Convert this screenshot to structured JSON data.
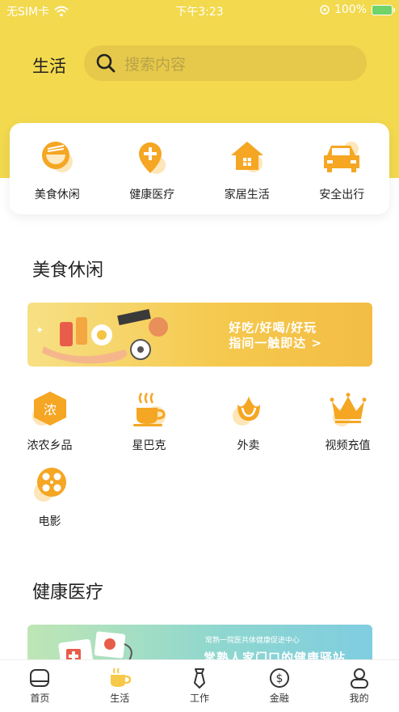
{
  "status_bar": {
    "carrier": "无SIM卡",
    "time": "下午3:23",
    "battery": "100%"
  },
  "header": {
    "title": "生活",
    "search_placeholder": "搜索内容"
  },
  "categories": [
    {
      "label": "美食休闲",
      "icon": "bowl-icon"
    },
    {
      "label": "健康医疗",
      "icon": "medical-pin-icon"
    },
    {
      "label": "家居生活",
      "icon": "house-icon"
    },
    {
      "label": "安全出行",
      "icon": "car-icon"
    }
  ],
  "food_section": {
    "title": "美食休闲",
    "banner": {
      "line1": "好吃/好喝/好玩",
      "line2": "指间一触即达 >"
    },
    "items": [
      {
        "label": "浓农乡品",
        "icon": "farm-product-icon"
      },
      {
        "label": "星巴克",
        "icon": "coffee-cup-icon"
      },
      {
        "label": "外卖",
        "icon": "takeout-icon"
      },
      {
        "label": "视频充值",
        "icon": "crown-icon"
      },
      {
        "label": "电影",
        "icon": "film-reel-icon"
      }
    ]
  },
  "health_section": {
    "title": "健康医疗",
    "banner": {
      "line1": "常熟一院医共体健康促进中心",
      "line2": "常熟人家门口的健康驿站"
    }
  },
  "tabbar": [
    {
      "label": "首页",
      "icon": "home-icon",
      "active": false
    },
    {
      "label": "生活",
      "icon": "coffee-tab-icon",
      "active": true
    },
    {
      "label": "工作",
      "icon": "tie-icon",
      "active": false
    },
    {
      "label": "金融",
      "icon": "dollar-icon",
      "active": false
    },
    {
      "label": "我的",
      "icon": "person-icon",
      "active": false
    }
  ],
  "colors": {
    "brand_yellow": "#f2d94e",
    "icon_orange": "#f5a623",
    "icon_yellow": "#f7c948"
  }
}
